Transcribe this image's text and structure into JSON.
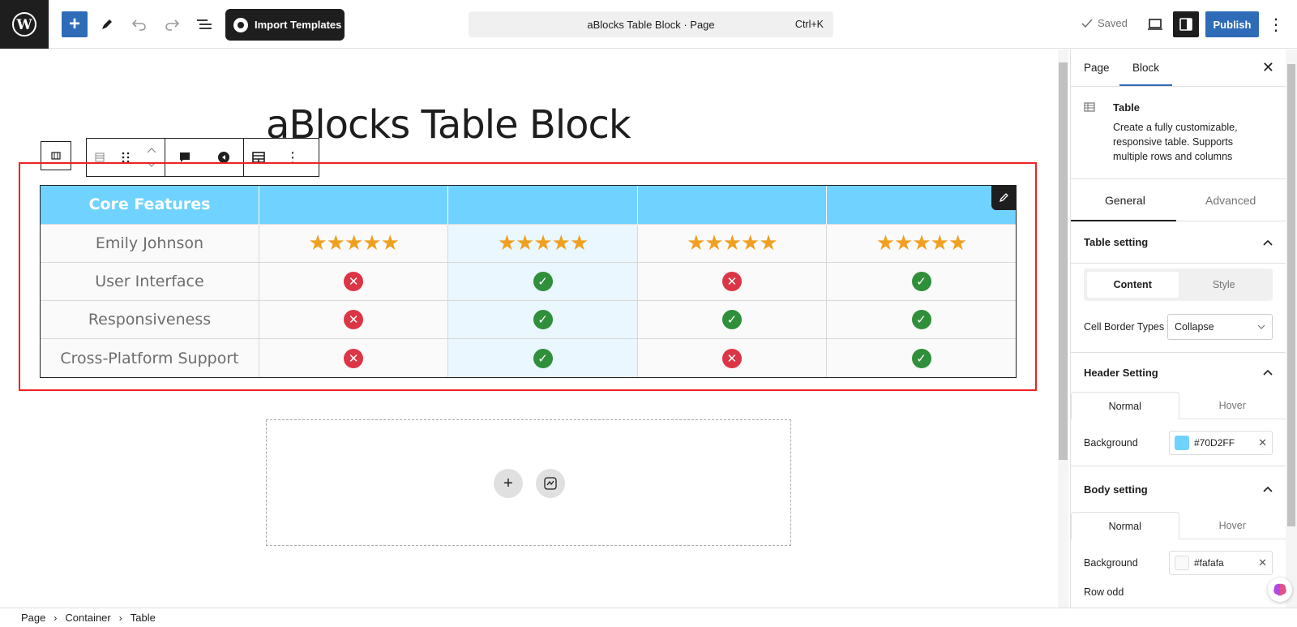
{
  "topbar": {
    "import_label": "Import Templates",
    "command_title": "aBlocks Table Block · Page",
    "command_shortcut": "Ctrl+K",
    "saved_label": "Saved",
    "publish_label": "Publish"
  },
  "canvas": {
    "page_title": "aBlocks Table Block"
  },
  "table": {
    "header": [
      "Core Features",
      "",
      "",
      "",
      ""
    ],
    "rows": [
      {
        "label": "Emily Johnson",
        "cells": [
          "★★★★★",
          "★★★★★",
          "★★★★★",
          "★★★★★"
        ]
      },
      {
        "label": "User Interface",
        "cells": [
          "x",
          "check",
          "x",
          "check"
        ]
      },
      {
        "label": "Responsiveness",
        "cells": [
          "x",
          "check",
          "check",
          "check"
        ]
      },
      {
        "label": "Cross-Platform Support",
        "cells": [
          "x",
          "check",
          "x",
          "check"
        ]
      }
    ],
    "header_color": "#70D2FF",
    "check_color": "#2f8f3a",
    "x_color": "#dc3545"
  },
  "sidebar": {
    "tab_page": "Page",
    "tab_block": "Block",
    "block_title": "Table",
    "block_desc": "Create a fully customizable, responsive table. Supports multiple rows and columns",
    "tab_general": "General",
    "tab_advanced": "Advanced",
    "table_setting": "Table setting",
    "seg_content": "Content",
    "seg_style": "Style",
    "cell_border_label": "Cell Border Types",
    "cell_border_value": "Collapse",
    "header_setting": "Header Setting",
    "state_normal": "Normal",
    "state_hover": "Hover",
    "background_label": "Background",
    "header_bg_value": "#70D2FF",
    "body_setting": "Body setting",
    "body_bg_value": "#fafafa",
    "row_odd_label": "Row odd"
  },
  "breadcrumb": [
    "Page",
    "Container",
    "Table"
  ]
}
